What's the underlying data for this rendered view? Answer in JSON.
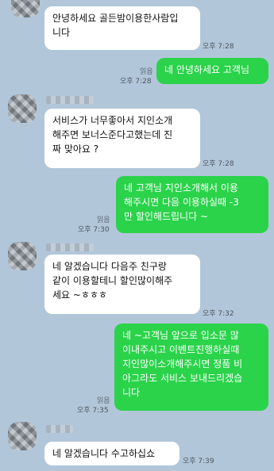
{
  "messages": [
    {
      "side": "in",
      "text": "안녕하세요 골든밤이용한사람입\n니다",
      "time": "오후 7:28"
    },
    {
      "side": "out",
      "text": "네 안녕하세요 고객님",
      "time": "오후 7:28",
      "read": "읽음"
    },
    {
      "side": "in",
      "text": "서비스가 너무좋아서 지인소개\n해주면 보너스준다고했는데 진\n짜 맞아요 ?",
      "time": "오후 7:28"
    },
    {
      "side": "out",
      "text": "네 고객님 지인소개해서 이용\n해주시면 다음 이용하실때 -3\n만 할인해드립니다 ~",
      "time": "오후 7:30",
      "read": "읽음"
    },
    {
      "side": "in",
      "text": "네 알겠습니다 다음주 친구랑\n같이 이용할테니 할인많이해주\n세요 ~ㅎㅎㅎ",
      "time": "오후 7:32"
    },
    {
      "side": "out",
      "text": "네 ~고객님 앞으로 입소문 많\n이내주시고 이벤트진행하실때\n지인많이소개해주시면 정품 비\n아그라도 서비스 보내드리겠습\n니다",
      "time": "오후 7:35",
      "read": "읽음"
    },
    {
      "side": "in",
      "text": "네 알겠습니다 수고하십쇼",
      "time": "오후 7:39"
    }
  ],
  "colors": {
    "background": "#b2c6d9",
    "incoming_bubble": "#ffffff",
    "outgoing_bubble": "#2ad34a"
  }
}
